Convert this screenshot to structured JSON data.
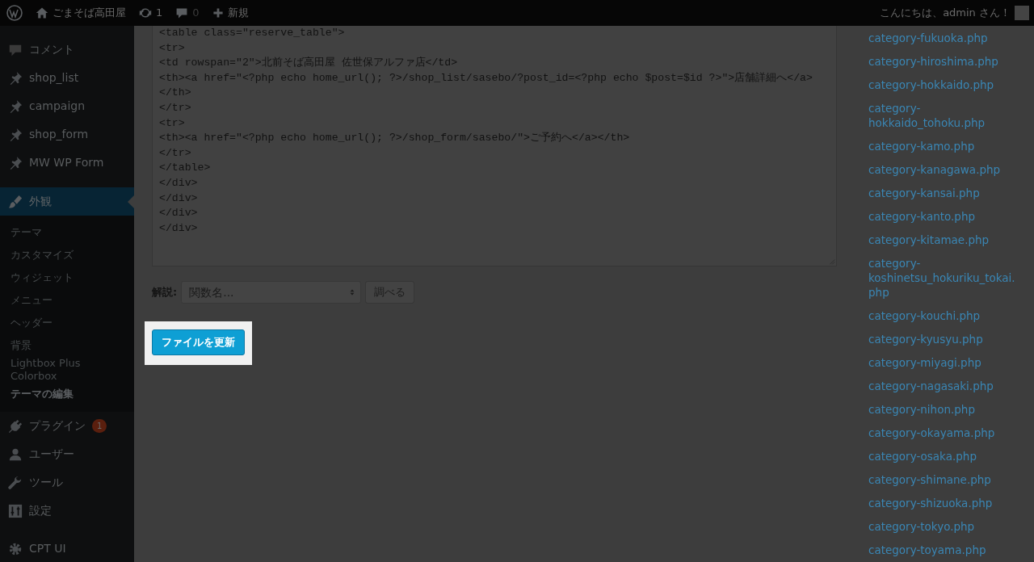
{
  "admin_bar": {
    "site_name": "ごまそば高田屋",
    "updates": "1",
    "comments": "0",
    "new_label": "新規",
    "greeting": "こんにちは、admin さん！"
  },
  "sidebar": {
    "items": [
      {
        "label": "コメント",
        "selected": false
      },
      {
        "label": "shop_list",
        "selected": false
      },
      {
        "label": "campaign",
        "selected": false
      },
      {
        "label": "shop_form",
        "selected": false
      },
      {
        "label": "MW WP Form",
        "selected": false
      },
      {
        "label": "外観",
        "selected": true,
        "children": [
          {
            "label": "テーマ",
            "selected": false
          },
          {
            "label": "カスタマイズ",
            "selected": false
          },
          {
            "label": "ウィジェット",
            "selected": false
          },
          {
            "label": "メニュー",
            "selected": false
          },
          {
            "label": "ヘッダー",
            "selected": false
          },
          {
            "label": "背景",
            "selected": false
          },
          {
            "label": "Lightbox Plus Colorbox",
            "selected": false
          },
          {
            "label": "テーマの編集",
            "selected": true
          }
        ]
      },
      {
        "label": "プラグイン",
        "selected": false,
        "badge": "1"
      },
      {
        "label": "ユーザー",
        "selected": false
      },
      {
        "label": "ツール",
        "selected": false
      },
      {
        "label": "設定",
        "selected": false
      },
      {
        "label": "CPT UI",
        "selected": false
      }
    ]
  },
  "editor": {
    "lines": [
      "<table class=\"reserve_table\">",
      "<tr>",
      "<td rowspan=\"2\">北前そば高田屋 佐世保アルファ店</td>",
      "<th><a href=\"<?php echo home_url(); ?>/shop_list/sasebo/?post_id=<?php echo $post=$id ?>\">店舗詳細へ</a>",
      "</th>",
      "</tr>",
      "<tr>",
      "<th><a href=\"<?php echo home_url(); ?>/shop_form/sasebo/\">ご予約へ</a></th>",
      "</tr>",
      "</table>",
      "</div>",
      "</div>",
      "</div>",
      "</div>"
    ]
  },
  "documentation": {
    "label": "解説:",
    "select_value": "関数名...",
    "button": "調べる"
  },
  "update_button": "ファイルを更新",
  "files": [
    "category-fukuoka.php",
    "category-hiroshima.php",
    "category-hokkaido.php",
    "category-hokkaido_tohoku.php",
    "category-kamo.php",
    "category-kanagawa.php",
    "category-kansai.php",
    "category-kanto.php",
    "category-kitamae.php",
    "category-koshinetsu_hokuriku_tokai.php",
    "category-kouchi.php",
    "category-kyusyu.php",
    "category-miyagi.php",
    "category-nagasaki.php",
    "category-nihon.php",
    "category-okayama.php",
    "category-osaka.php",
    "category-shimane.php",
    "category-shizuoka.php",
    "category-tokyo.php",
    "category-toyama.php"
  ]
}
